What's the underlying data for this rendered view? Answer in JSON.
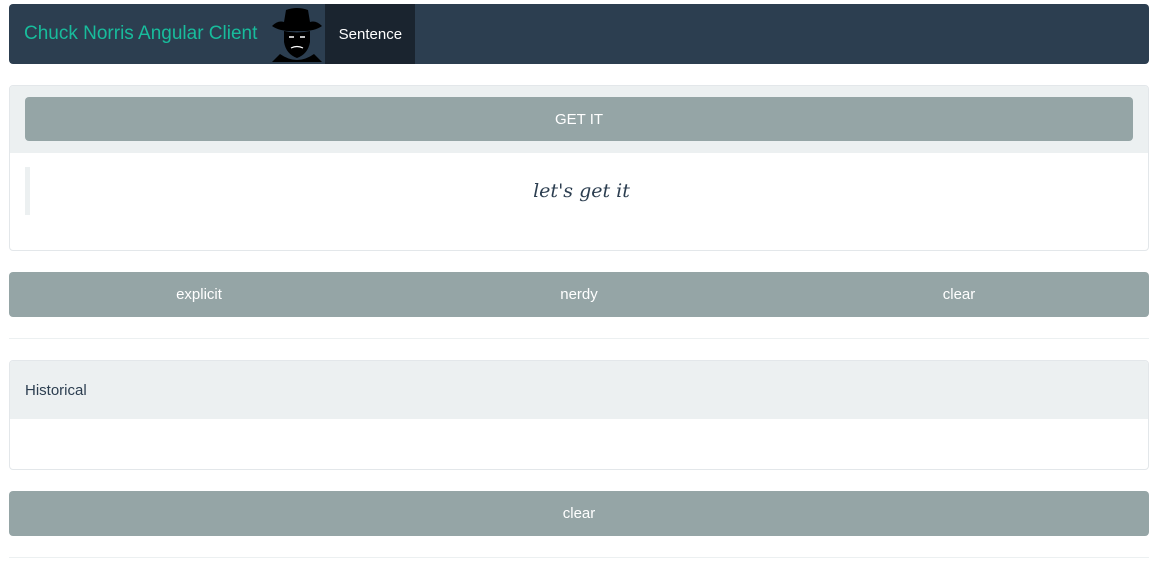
{
  "navbar": {
    "brand": "Chuck Norris Angular Client",
    "logo_icon": "chuck-norris-logo-icon",
    "nav_item": "Sentence"
  },
  "sentence_panel": {
    "get_button": "GET IT",
    "quote": "let's get it"
  },
  "options": {
    "explicit": "explicit",
    "nerdy": "nerdy",
    "clear": "clear"
  },
  "historical": {
    "title": "Historical",
    "items": []
  },
  "history_clear": "clear",
  "colors": {
    "navbar_bg": "#2c3e50",
    "brand": "#18bc9c",
    "active_nav": "#1a242f",
    "button": "#95a5a6",
    "panel_heading": "#ecf0f1"
  }
}
